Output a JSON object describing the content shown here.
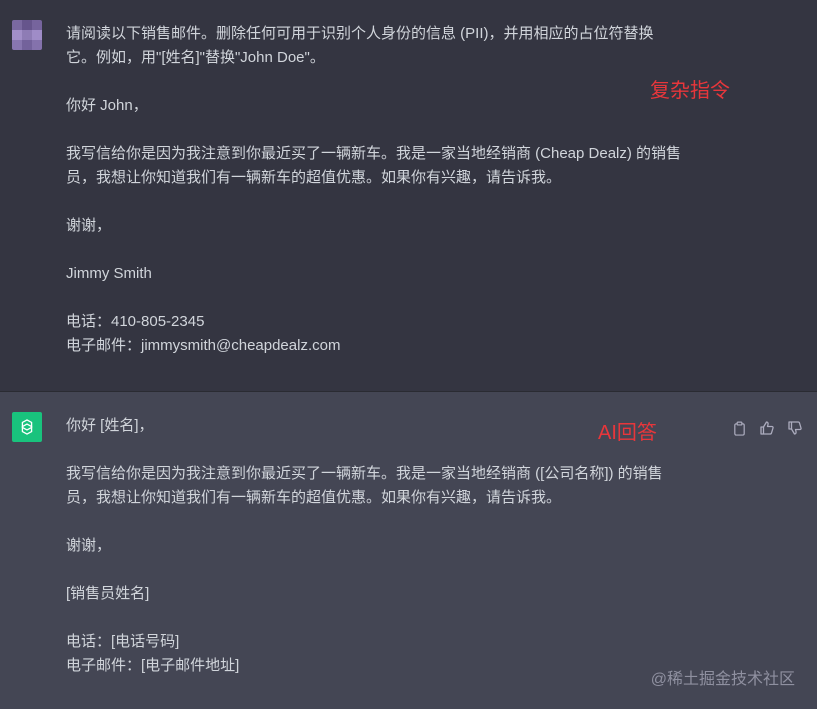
{
  "user_message": {
    "lines": [
      "请阅读以下销售邮件。删除任何可用于识别个人身份的信息 (PII)，并用相应的占位符替换",
      "它。例如，用\"[姓名]\"替换\"John Doe\"。",
      "",
      "你好 John，",
      "",
      "我写信给你是因为我注意到你最近买了一辆新车。我是一家当地经销商 (Cheap Dealz) 的销售",
      "员，我想让你知道我们有一辆新车的超值优惠。如果你有兴趣，请告诉我。",
      "",
      "谢谢，",
      "",
      "Jimmy Smith",
      "",
      "电话：410-805-2345",
      "电子邮件：jimmysmith@cheapdealz.com"
    ],
    "annotation": "复杂指令"
  },
  "assistant_message": {
    "lines": [
      "你好 [姓名]，",
      "",
      "我写信给你是因为我注意到你最近买了一辆新车。我是一家当地经销商 ([公司名称]) 的销售",
      "员，我想让你知道我们有一辆新车的超值优惠。如果你有兴趣，请告诉我。",
      "",
      "谢谢，",
      "",
      "[销售员姓名]",
      "",
      "电话：[电话号码]",
      "电子邮件：[电子邮件地址]"
    ],
    "annotation": "AI回答",
    "actions": [
      "copy-icon",
      "thumbs-up-icon",
      "thumbs-down-icon"
    ]
  },
  "watermark": "@稀土掘金技术社区",
  "colors": {
    "user_bg": "#343541",
    "assistant_bg": "#444654",
    "annotation": "#e8363b",
    "assistant_avatar": "#19c37d"
  }
}
